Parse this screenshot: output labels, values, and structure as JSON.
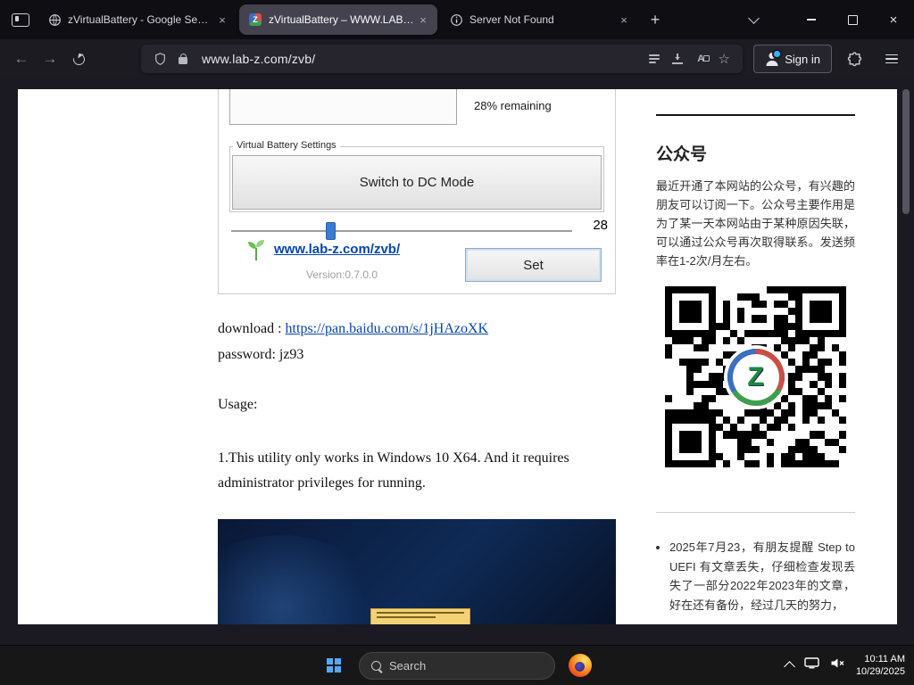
{
  "browser": {
    "tabs": [
      {
        "title": "zVirtualBattery - Google Search"
      },
      {
        "title": "zVirtualBattery – WWW.LAB-Z.C"
      },
      {
        "title": "Server Not Found"
      }
    ],
    "favicon_z_letter": "Z",
    "urlbar": {
      "url": "www.lab-z.com/zvb/"
    },
    "signin_label": "Sign in"
  },
  "page": {
    "app_screenshot": {
      "remaining": "28% remaining",
      "group_label": "Virtual Battery Settings",
      "switch_btn": "Switch to DC Mode",
      "slider_value": "28",
      "site_link": "www.lab-z.com/zvb/",
      "version": "Version:0.7.0.0",
      "set_btn": "Set"
    },
    "download_label": "download : ",
    "download_link": "https://pan.baidu.com/s/1jHAzoXK",
    "password_line": "password: jz93",
    "usage_heading": "Usage:",
    "usage_item": "1.This utility only works in Windows 10 X64. And it requires administrator privileges for running.",
    "sidebar": {
      "heading": "公众号",
      "intro": "最近开通了本网站的公众号，有兴趣的朋友可以订阅一下。公众号主要作用是为了某一天本网站由于某种原因失联，可以通过公众号再次取得联系。发送频率在1-2次/月左右。",
      "logo_letter": "Z",
      "news_item": "2025年7月23，有朋友提醒 Step to UEFI 有文章丢失，仔细检查发现丢失了一部分2022年2023年的文章，好在还有备份，经过几天的努力，"
    }
  },
  "taskbar": {
    "search_placeholder": "Search",
    "clock_time": "10:11 AM",
    "clock_date": "10/29/2025"
  },
  "glyphs": {
    "back": "←",
    "forward": "→",
    "close": "×",
    "plus": "+",
    "star": "☆",
    "translate": "A"
  }
}
